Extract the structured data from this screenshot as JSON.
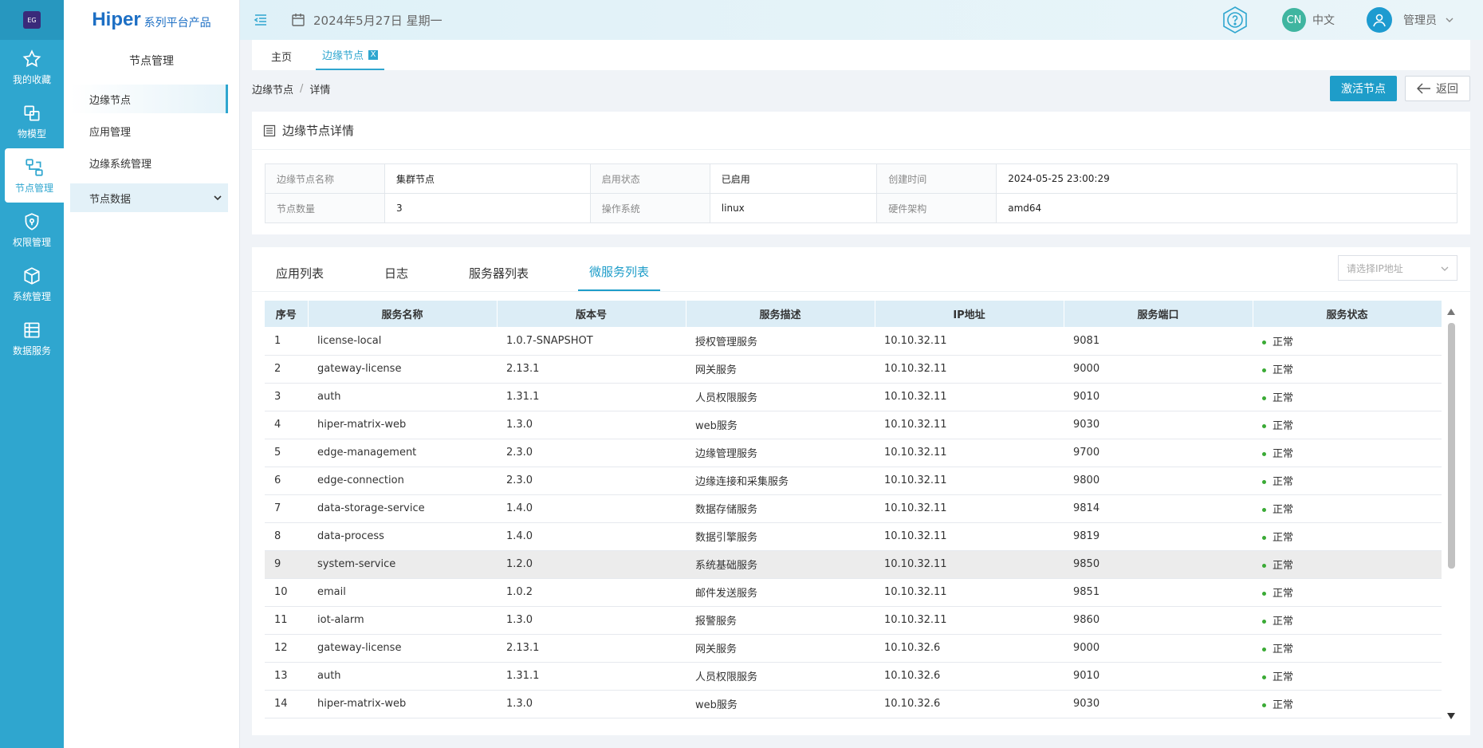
{
  "rail": {
    "logo_text": "EG",
    "items": [
      {
        "label": "我的收藏",
        "icon": "star-icon"
      },
      {
        "label": "物模型",
        "icon": "model-icon"
      },
      {
        "label": "节点管理",
        "icon": "node-icon"
      },
      {
        "label": "权限管理",
        "icon": "shield-icon"
      },
      {
        "label": "系统管理",
        "icon": "cube-icon"
      },
      {
        "label": "数据服务",
        "icon": "database-icon"
      }
    ]
  },
  "brand": {
    "main": "Hiper",
    "sub": "系列平台产品"
  },
  "sidebar": {
    "title": "节点管理",
    "items": [
      {
        "label": "边缘节点"
      },
      {
        "label": "应用管理"
      },
      {
        "label": "边缘系统管理"
      },
      {
        "label": "节点数据"
      }
    ]
  },
  "topbar": {
    "date": "2024年5月27日 星期一",
    "lang_badge": "CN",
    "lang": "中文",
    "user": "管理员"
  },
  "page_tabs": [
    {
      "label": "主页"
    },
    {
      "label": "边缘节点",
      "close": "X"
    }
  ],
  "breadcrumb": {
    "parent": "边缘节点",
    "sep": "/",
    "current": "详情"
  },
  "actions": {
    "activate": "激活节点",
    "back": "返回"
  },
  "detail": {
    "title": "边缘节点详情",
    "rows": [
      [
        {
          "k": "边缘节点名称",
          "v": "集群节点"
        },
        {
          "k": "启用状态",
          "v": "已启用"
        },
        {
          "k": "创建时间",
          "v": "2024-05-25 23:00:29"
        }
      ],
      [
        {
          "k": "节点数量",
          "v": "3"
        },
        {
          "k": "操作系统",
          "v": "linux"
        },
        {
          "k": "硬件架构",
          "v": "amd64"
        }
      ]
    ]
  },
  "list_tabs": [
    {
      "label": "应用列表"
    },
    {
      "label": "日志"
    },
    {
      "label": "服务器列表"
    },
    {
      "label": "微服务列表"
    }
  ],
  "ip_select_placeholder": "请选择IP地址",
  "table": {
    "headers": [
      "序号",
      "服务名称",
      "版本号",
      "服务描述",
      "IP地址",
      "服务端口",
      "服务状态"
    ],
    "rows": [
      [
        "1",
        "license-local",
        "1.0.7-SNAPSHOT",
        "授权管理服务",
        "10.10.32.11",
        "9081",
        "正常"
      ],
      [
        "2",
        "gateway-license",
        "2.13.1",
        "网关服务",
        "10.10.32.11",
        "9000",
        "正常"
      ],
      [
        "3",
        "auth",
        "1.31.1",
        "人员权限服务",
        "10.10.32.11",
        "9010",
        "正常"
      ],
      [
        "4",
        "hiper-matrix-web",
        "1.3.0",
        "web服务",
        "10.10.32.11",
        "9030",
        "正常"
      ],
      [
        "5",
        "edge-management",
        "2.3.0",
        "边缘管理服务",
        "10.10.32.11",
        "9700",
        "正常"
      ],
      [
        "6",
        "edge-connection",
        "2.3.0",
        "边缘连接和采集服务",
        "10.10.32.11",
        "9800",
        "正常"
      ],
      [
        "7",
        "data-storage-service",
        "1.4.0",
        "数据存储服务",
        "10.10.32.11",
        "9814",
        "正常"
      ],
      [
        "8",
        "data-process",
        "1.4.0",
        "数据引擎服务",
        "10.10.32.11",
        "9819",
        "正常"
      ],
      [
        "9",
        "system-service",
        "1.2.0",
        "系统基础服务",
        "10.10.32.11",
        "9850",
        "正常"
      ],
      [
        "10",
        "email",
        "1.0.2",
        "邮件发送服务",
        "10.10.32.11",
        "9851",
        "正常"
      ],
      [
        "11",
        "iot-alarm",
        "1.3.0",
        "报警服务",
        "10.10.32.11",
        "9860",
        "正常"
      ],
      [
        "12",
        "gateway-license",
        "2.13.1",
        "网关服务",
        "10.10.32.6",
        "9000",
        "正常"
      ],
      [
        "13",
        "auth",
        "1.31.1",
        "人员权限服务",
        "10.10.32.6",
        "9010",
        "正常"
      ],
      [
        "14",
        "hiper-matrix-web",
        "1.3.0",
        "web服务",
        "10.10.32.6",
        "9030",
        "正常"
      ]
    ]
  },
  "colors": {
    "accent": "#2fa6cf",
    "status_ok": "#3aaa35"
  }
}
